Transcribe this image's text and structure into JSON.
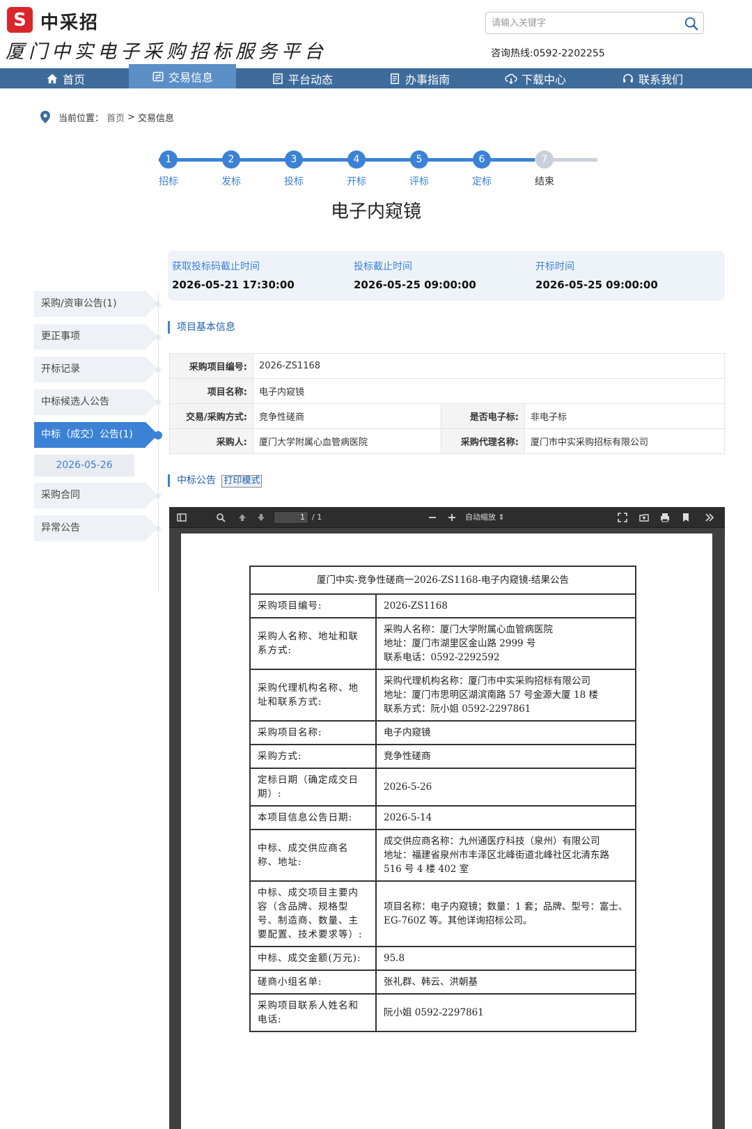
{
  "header": {
    "logo_mark": "S",
    "logo_name": "中采招",
    "platform_title": "厦门中实电子采购招标服务平台",
    "search_placeholder": "请输入关键字",
    "hotline": "咨询热线:0592-2202255"
  },
  "nav": {
    "items": [
      {
        "label": "首页",
        "icon": "home-icon"
      },
      {
        "label": "交易信息",
        "icon": "exchange-icon"
      },
      {
        "label": "平台动态",
        "icon": "news-icon"
      },
      {
        "label": "办事指南",
        "icon": "guide-icon"
      },
      {
        "label": "下载中心",
        "icon": "download-icon"
      },
      {
        "label": "联系我们",
        "icon": "headset-icon"
      }
    ],
    "active": "交易信息"
  },
  "breadcrumb": {
    "prefix": "当前位置：",
    "home": "首页",
    "sep": ">",
    "current": "交易信息"
  },
  "steps": [
    {
      "num": "1",
      "label": "招标",
      "done": true
    },
    {
      "num": "2",
      "label": "发标",
      "done": true
    },
    {
      "num": "3",
      "label": "投标",
      "done": true
    },
    {
      "num": "4",
      "label": "开标",
      "done": true
    },
    {
      "num": "5",
      "label": "评标",
      "done": true
    },
    {
      "num": "6",
      "label": "定标",
      "done": true
    },
    {
      "num": "7",
      "label": "结束",
      "done": false
    }
  ],
  "page_title": "电子内窥镜",
  "times": [
    {
      "label": "获取投标码截止时间",
      "value": "2026-05-21 17:30:00"
    },
    {
      "label": "投标截止时间",
      "value": "2026-05-25 09:00:00"
    },
    {
      "label": "开标时间",
      "value": "2026-05-25 09:00:00"
    }
  ],
  "sidebar": {
    "items": [
      "采购/资审公告(1)",
      "更正事项",
      "开标记录",
      "中标候选人公告",
      "中标（成交）公告(1)",
      "采购合同",
      "异常公告"
    ],
    "active": "中标（成交）公告(1)",
    "sub_item": "2026-05-26"
  },
  "basic_info": {
    "section_title": "项目基本信息",
    "project_no_label": "采购项目编号:",
    "project_no": "2026-ZS1168",
    "project_name_label": "项目名称:",
    "project_name": "电子内窥镜",
    "method_label": "交易/采购方式:",
    "method": "竞争性磋商",
    "electronic_label": "是否电子标:",
    "electronic": "非电子标",
    "buyer_label": "采购人:",
    "buyer": "厦门大学附属心血管病医院",
    "agent_label": "采购代理名称:",
    "agent": "厦门市中实采购招标有限公司"
  },
  "notice": {
    "section_title": "中标公告",
    "print_label": "打印模式"
  },
  "viewer": {
    "page_current": "1",
    "page_total": "/ 1",
    "zoom": "自动缩放"
  },
  "doc": {
    "title": "厦门中实-竞争性磋商一2026-ZS1168-电子内窥镜-结果公告",
    "rows": [
      {
        "k": "采购项目编号:",
        "v": [
          "2026-ZS1168"
        ]
      },
      {
        "k": "采购人名称、地址和联系方式:",
        "v": [
          "采购人名称：厦门大学附属心血管病医院",
          "地址：厦门市湖里区金山路 2999 号",
          "联系电话：0592-2292592"
        ]
      },
      {
        "k": "采购代理机构名称、地址和联系方式:",
        "v": [
          "采购代理机构名称：厦门市中实采购招标有限公司",
          "地址：厦门市思明区湖滨南路 57 号金源大厦 18 楼",
          "联系方式：阮小姐  0592-2297861"
        ]
      },
      {
        "k": "采购项目名称:",
        "v": [
          "电子内窥镜"
        ]
      },
      {
        "k": "采购方式:",
        "v": [
          "竞争性磋商"
        ]
      },
      {
        "k": "定标日期（确定成交日期）:",
        "v": [
          "2026-5-26"
        ]
      },
      {
        "k": "本项目信息公告日期:",
        "v": [
          "2026-5-14"
        ]
      },
      {
        "k": "中标、成交供应商名称、地址:",
        "v": [
          "成交供应商名称：九州通医疗科技（泉州）有限公司",
          "地址：福建省泉州市丰泽区北峰街道北峰社区北清东路 516 号 4 楼 402 室"
        ]
      },
      {
        "k": "中标、成交项目主要内容（含品牌、规格型号、制造商、数量、主要配置、技术要求等）:",
        "v": [
          "项目名称：电子内窥镜；数量：1 套；品牌、型号：富士、EG-760Z 等。其他详询招标公司。"
        ]
      },
      {
        "k": "中标、成交金额(万元):",
        "v": [
          "95.8"
        ]
      },
      {
        "k": "磋商小组名单:",
        "v": [
          "张礼群、韩云、洪朝基"
        ]
      },
      {
        "k": "采购项目联系人姓名和电话:",
        "v": [
          "阮小姐 0592-2297861"
        ]
      }
    ]
  },
  "colors": {
    "brand_red": "#d9262c",
    "nav_bg": "#3d6b9a",
    "nav_active": "#5c8fc6",
    "accent_blue": "#3b82d6"
  }
}
